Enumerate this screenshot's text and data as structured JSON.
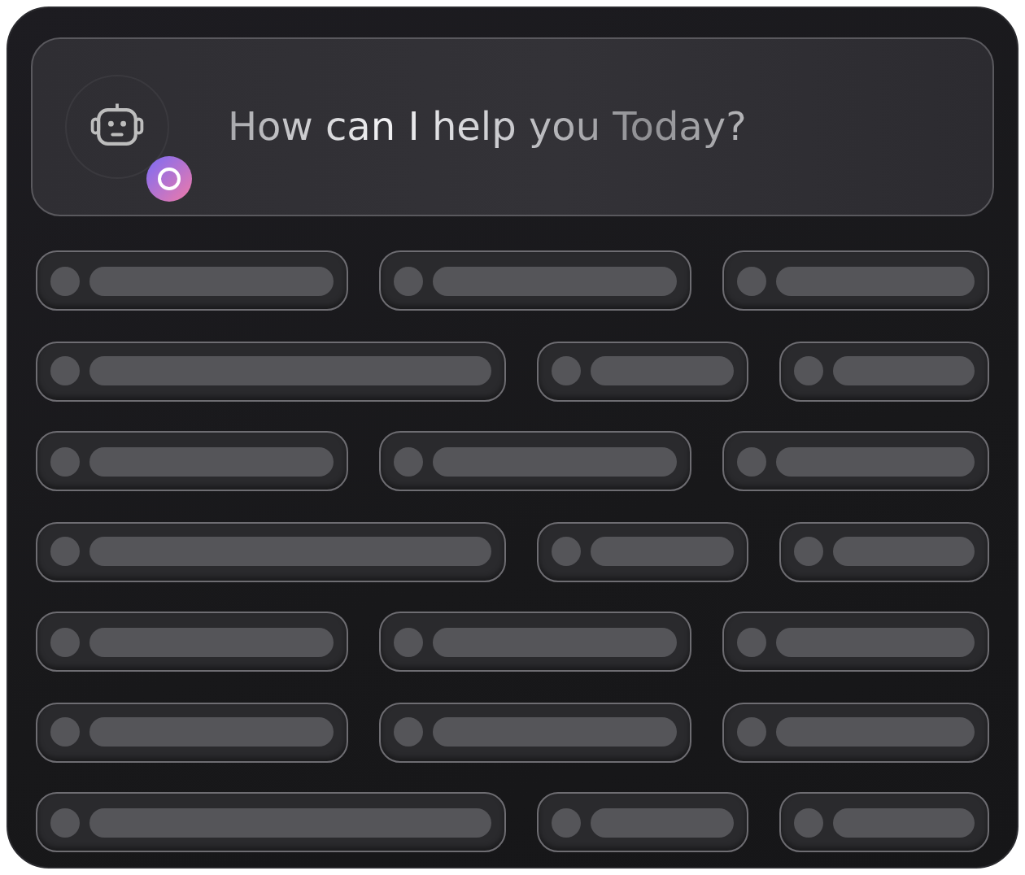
{
  "prompt": {
    "text": "How can I help you Today?"
  },
  "suggestion_rows": [
    {
      "kind": "thirds"
    },
    {
      "kind": "wide"
    },
    {
      "kind": "thirds"
    },
    {
      "kind": "wide"
    },
    {
      "kind": "thirds"
    },
    {
      "kind": "thirds"
    },
    {
      "kind": "wide"
    }
  ]
}
